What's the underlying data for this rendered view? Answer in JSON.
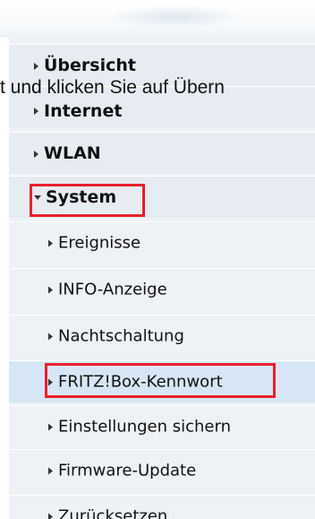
{
  "overlay_text": "t und klicken Sie auf  Übern",
  "menu": {
    "level1": [
      {
        "label": "Übersicht",
        "arrow": "arrow-right-icon"
      },
      {
        "label": "Internet",
        "arrow": "arrow-right-icon"
      },
      {
        "label": "WLAN",
        "arrow": "arrow-right-icon"
      },
      {
        "label": "System",
        "arrow": "arrow-down-icon",
        "expanded": true,
        "highlighted": true
      }
    ],
    "system_sub": [
      {
        "label": "Ereignisse",
        "arrow": "arrow-right-icon"
      },
      {
        "label": "INFO-Anzeige",
        "arrow": "arrow-right-icon"
      },
      {
        "label": "Nachtschaltung",
        "arrow": "arrow-right-icon"
      },
      {
        "label": "FRITZ!Box-Kennwort",
        "arrow": "arrow-right-icon",
        "selected": true,
        "highlighted": true
      },
      {
        "label": "Einstellungen sichern",
        "arrow": "arrow-right-icon"
      },
      {
        "label": "Firmware-Update",
        "arrow": "arrow-right-icon"
      },
      {
        "label": "Zurücksetzen",
        "arrow": "arrow-right-icon"
      }
    ]
  },
  "colors": {
    "highlight_border": "#e8202a",
    "selected_bg": "#d6e6f4",
    "menu_bg": "#eef2f6"
  }
}
